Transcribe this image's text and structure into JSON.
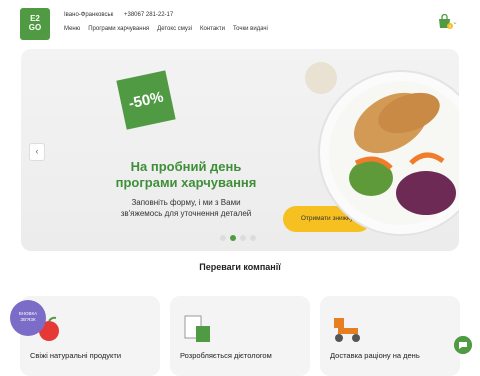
{
  "header": {
    "logo_top": "E2",
    "logo_bottom": "GO",
    "city": "Івано-Франковськ",
    "phone": "+38067 281-22-17",
    "nav": [
      "Меню",
      "Програми харчування",
      "Детокс смузі",
      "Контакти",
      "Точки видачі"
    ],
    "cart_count": "0"
  },
  "hero": {
    "discount": "-50%",
    "title_line1": "На пробний день",
    "title_line2": "програми харчування",
    "text_line1": "Заповніть форму, і ми з Вами",
    "text_line2": "зв'яжемось для уточнення деталей",
    "cta": "Отримати знижку",
    "slides": 4,
    "active_slide": 2
  },
  "benefits": {
    "title": "Переваги компанії",
    "cards": [
      "Свіжі натуральні продукти",
      "Розробляється дієтологом",
      "Доставка раціону на день"
    ]
  },
  "badge": {
    "line1": "ВНОВКА",
    "line2": "ЗВ'ЯЗК"
  },
  "colors": {
    "brand": "#4f9a43",
    "accent": "#f6c021"
  }
}
